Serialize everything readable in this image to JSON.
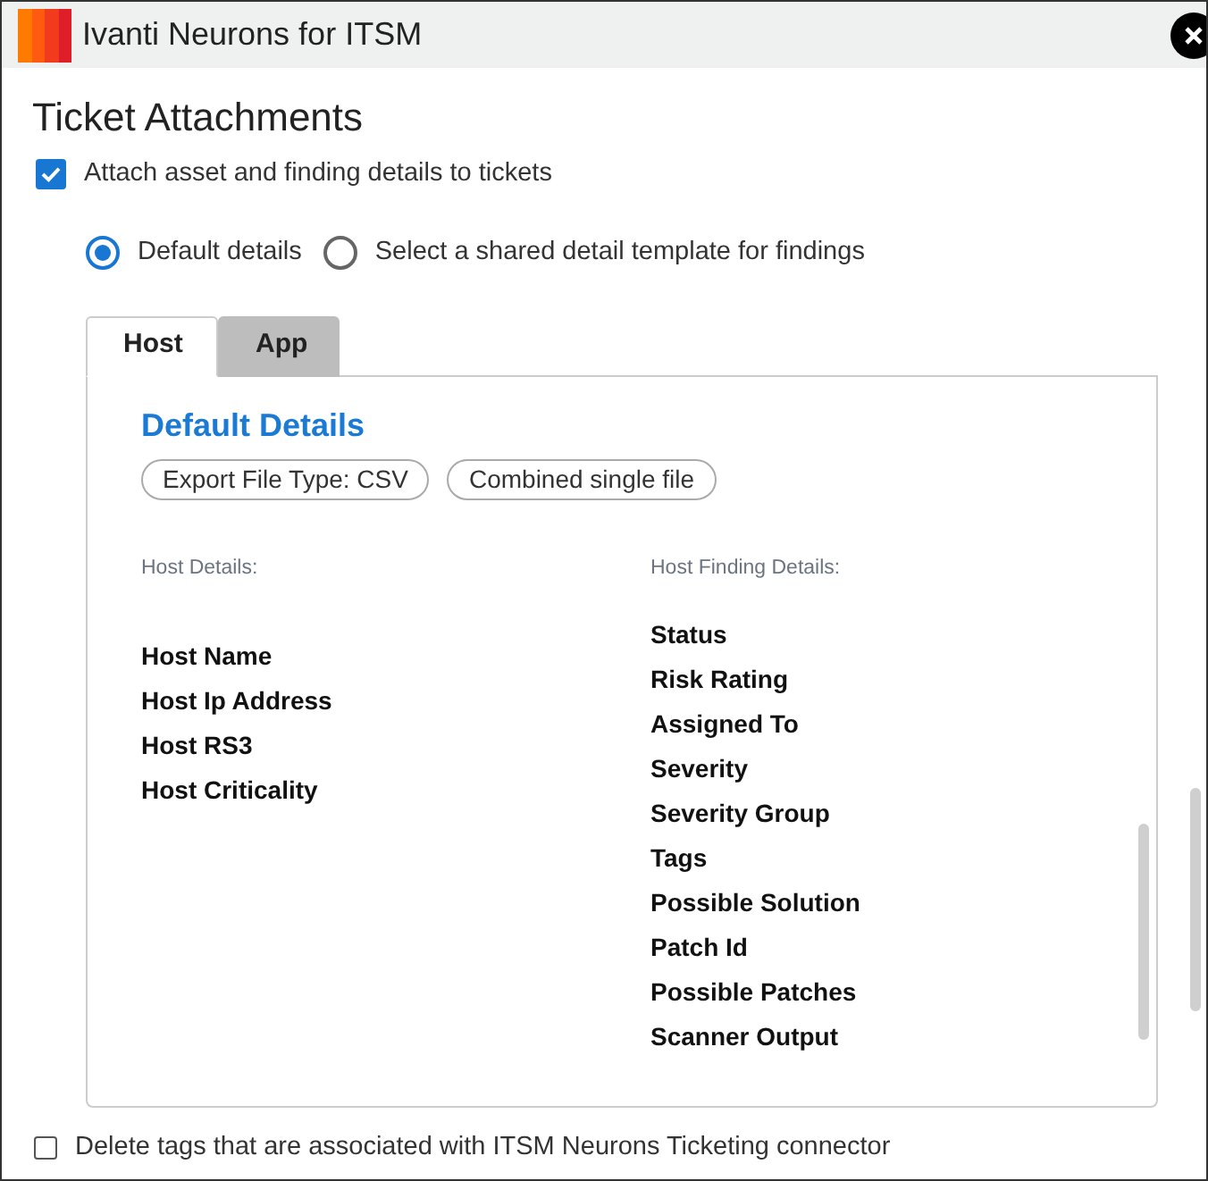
{
  "window": {
    "title": "Ivanti Neurons for ITSM"
  },
  "section_title": "Ticket Attachments",
  "attach_checkbox": {
    "label": "Attach asset and finding details to tickets",
    "checked": true
  },
  "detail_options": [
    {
      "label": "Default details",
      "selected": true
    },
    {
      "label": "Select a shared detail template for findings",
      "selected": false
    }
  ],
  "tabs": [
    {
      "label": "Host",
      "selected": true
    },
    {
      "label": "App",
      "selected": false
    }
  ],
  "panel": {
    "heading": "Default Details",
    "chips": [
      "Export File Type: CSV",
      "Combined single file"
    ],
    "columns": [
      {
        "label": "Host Details:",
        "items": [
          "Host Name",
          "Host Ip Address",
          "Host RS3",
          "Host Criticality"
        ]
      },
      {
        "label": "Host Finding Details:",
        "items": [
          "Status",
          "Risk Rating",
          "Assigned To",
          "Severity",
          "Severity Group",
          "Tags",
          "Possible Solution",
          "Patch Id",
          "Possible Patches",
          "Scanner Output"
        ]
      }
    ]
  },
  "delete_tags_checkbox": {
    "label": "Delete tags that are associated with ITSM Neurons Ticketing connector",
    "checked": false
  }
}
